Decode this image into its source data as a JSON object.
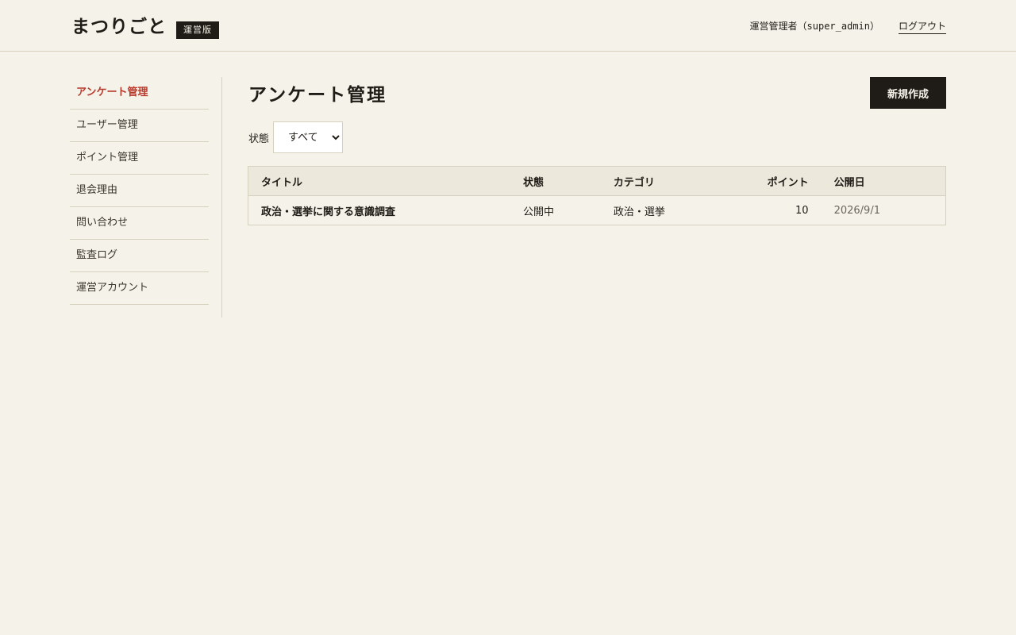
{
  "header": {
    "logo": "まつりごと",
    "edition_badge": "運営版",
    "user_label": "運営管理者（super_admin）",
    "logout_label": "ログアウト"
  },
  "sidebar": {
    "items": [
      {
        "label": "アンケート管理",
        "active": true
      },
      {
        "label": "ユーザー管理"
      },
      {
        "label": "ポイント管理"
      },
      {
        "label": "退会理由"
      },
      {
        "label": "問い合わせ"
      },
      {
        "label": "監査ログ"
      },
      {
        "label": "運営アカウント"
      }
    ]
  },
  "main": {
    "title": "アンケート管理",
    "new_button_label": "新規作成",
    "filter": {
      "label": "状態",
      "selected": "すべて"
    },
    "table": {
      "headers": [
        "タイトル",
        "状態",
        "カテゴリ",
        "ポイント",
        "公開日"
      ],
      "rows": [
        {
          "title": "政治・選挙に関する意識調査",
          "status": "公開中",
          "category": "政治・選挙",
          "points": "10",
          "published": "2026/9/1"
        }
      ]
    }
  },
  "colors": {
    "background": "#f5f2e9",
    "accent": "#b83a2c",
    "dark": "#1f1c17",
    "border": "#d6d0bf",
    "table_header": "#ede8dc"
  }
}
